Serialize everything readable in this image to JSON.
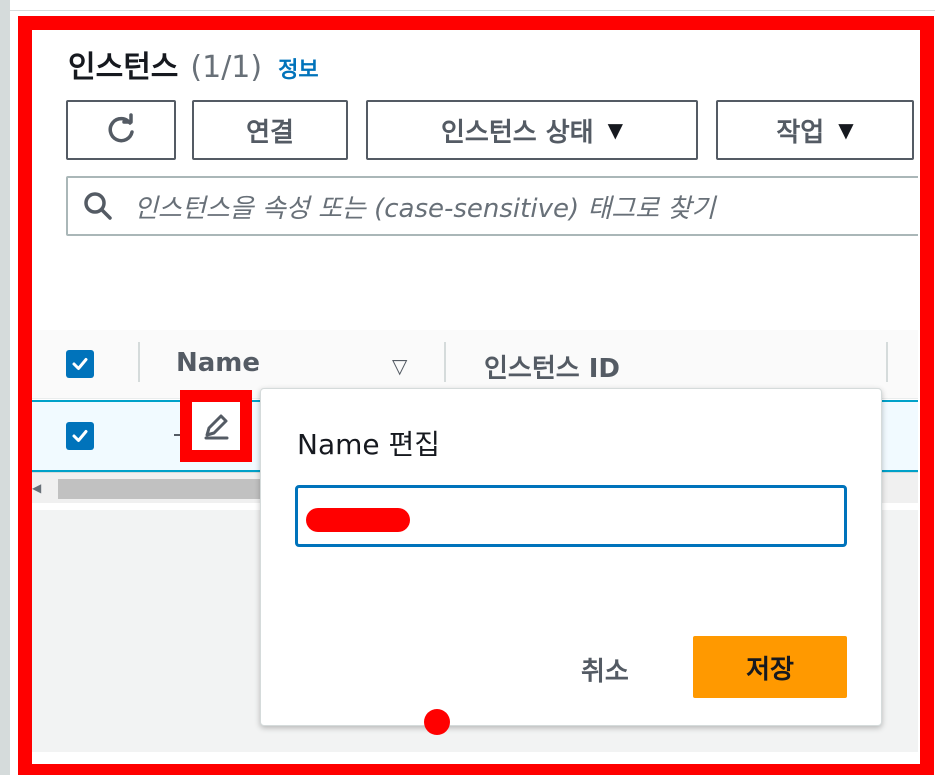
{
  "header": {
    "title": "인스턴스",
    "count": "(1/1)",
    "info_link": "정보"
  },
  "toolbar": {
    "connect_label": "연결",
    "instance_state_label": "인스턴스 상태",
    "actions_label": "작업",
    "caret": "▼"
  },
  "search": {
    "placeholder": "인스턴스을 속성 또는 (case-sensitive) 태그로 찾기"
  },
  "table": {
    "columns": [
      "Name",
      "인스턴스 ID"
    ],
    "sort_glyph": "▽",
    "rows": [
      {
        "selected": true,
        "name": "-"
      }
    ]
  },
  "edit_popover": {
    "title": "Name 편집",
    "input_value": "",
    "cancel_label": "취소",
    "save_label": "저장"
  },
  "colors": {
    "highlight": "#ff0000",
    "primary_button": "#ff9900",
    "link": "#0073bb",
    "checkbox": "#0073bb"
  },
  "icons": [
    "refresh-icon",
    "search-icon",
    "edit-pencil-icon",
    "checkbox-checked-icon",
    "caret-down-icon",
    "sort-icon"
  ]
}
